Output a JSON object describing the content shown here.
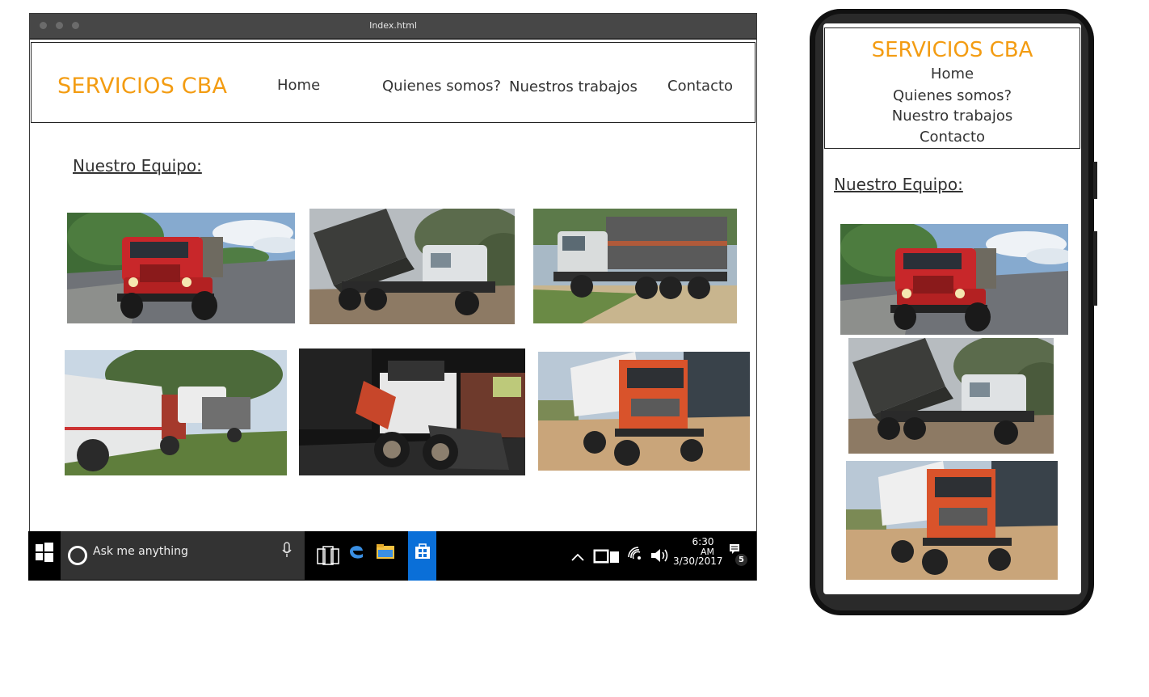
{
  "window": {
    "title": "Index.html"
  },
  "site": {
    "brand": "SERVICIOS CBA",
    "nav": {
      "home": "Home",
      "about": "Quienes somos?",
      "work": "Nuestros trabajos",
      "contact": "Contacto"
    },
    "section_title": "Nuestro Equipo:"
  },
  "mobile": {
    "brand": "SERVICIOS CBA",
    "nav": {
      "home": "Home",
      "about": "Quienes somos?",
      "work": "Nuestro trabajos",
      "contact": "Contacto"
    },
    "section_title": "Nuestro Equipo:"
  },
  "taskbar": {
    "search_placeholder": "Ask me anything",
    "clock_time": "6:30",
    "clock_ampm": "AM",
    "clock_date": "3/30/2017",
    "notification_count": "5"
  },
  "colors": {
    "brand": "#f39c12",
    "taskbar": "#000000",
    "store_active": "#0a6fd8"
  },
  "icons": [
    "windows-start-icon",
    "cortana-icon",
    "microphone-icon",
    "task-view-icon",
    "edge-icon",
    "file-explorer-icon",
    "store-icon",
    "chevron-up-icon",
    "tablet-mode-icon",
    "wifi-icon",
    "volume-icon",
    "action-center-icon"
  ]
}
